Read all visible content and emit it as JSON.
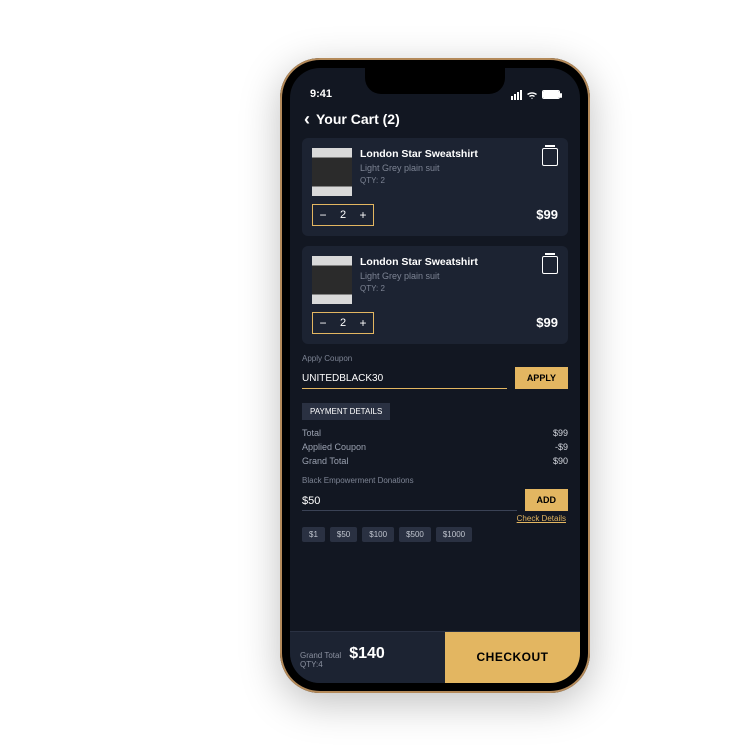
{
  "status": {
    "time": "9:41"
  },
  "header": {
    "title": "Your Cart (2)"
  },
  "items": [
    {
      "title": "London Star Sweatshirt",
      "subtitle": "Light Grey plain suit",
      "qtyLabel": "QTY: 2",
      "qty": "2",
      "price": "$99"
    },
    {
      "title": "London Star Sweatshirt",
      "subtitle": "Light Grey plain suit",
      "qtyLabel": "QTY: 2",
      "qty": "2",
      "price": "$99"
    }
  ],
  "coupon": {
    "label": "Apply Coupon",
    "value": "UNITEDBLACK30",
    "applyLabel": "APPLY"
  },
  "payment": {
    "badge": "PAYMENT DETAILS",
    "rows": [
      {
        "label": "Total",
        "value": "$99"
      },
      {
        "label": "Applied Coupon",
        "value": "-$9"
      },
      {
        "label": "Grand Total",
        "value": "$90"
      }
    ]
  },
  "donation": {
    "label": "Black Empowerment Donations",
    "amount": "$50",
    "addLabel": "ADD",
    "checkDetails": "Check Details",
    "chips": [
      "$1",
      "$50",
      "$100",
      "$500",
      "$1000"
    ]
  },
  "footer": {
    "grandTotalLabel": "Grand Total",
    "qtyLabel": "QTY:4",
    "total": "$140",
    "checkout": "CHECKOUT"
  }
}
